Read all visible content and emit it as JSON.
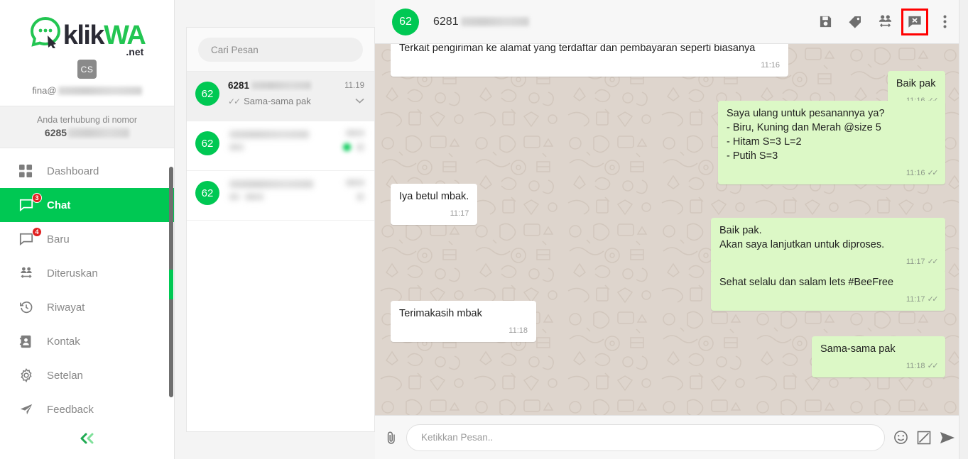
{
  "brand": {
    "logo_klik": "klik",
    "logo_wa": "WA",
    "logo_net": ".net",
    "accent_green": "#00c853",
    "badge_red": "#e02020",
    "highlight_red": "#ff0000",
    "bubble_out": "#dcf8c6",
    "bubble_in": "#ffffff",
    "chat_bg": "#ded5cd"
  },
  "sidebar": {
    "avatar_initials": "CS",
    "user_email_visible": "fina@",
    "connected_label": "Anda terhubung di nomor",
    "connected_number_visible": "6285",
    "items": [
      {
        "label": "Dashboard",
        "icon": "grid-icon",
        "badge": "",
        "active": false
      },
      {
        "label": "Chat",
        "icon": "chat-bubble-icon",
        "badge": "3",
        "active": true
      },
      {
        "label": "Baru",
        "icon": "chat-bubble-icon",
        "badge": "4",
        "active": false
      },
      {
        "label": "Diteruskan",
        "icon": "forward-people-icon",
        "badge": "",
        "active": false
      },
      {
        "label": "Riwayat",
        "icon": "history-clock-icon",
        "badge": "",
        "active": false
      },
      {
        "label": "Kontak",
        "icon": "contact-book-icon",
        "badge": "",
        "active": false
      },
      {
        "label": "Setelan",
        "icon": "gear-icon",
        "badge": "",
        "active": false
      },
      {
        "label": "Feedback",
        "icon": "paper-plane-icon",
        "badge": "",
        "active": false
      }
    ],
    "collapse_icon": "double-chevron-left-icon"
  },
  "chat_list": {
    "search_placeholder": "Cari Pesan",
    "rows": [
      {
        "avatar": "62",
        "name": "6281",
        "name_redacted": true,
        "time": "11.19",
        "snippet": "Sama-sama pak",
        "ticks": "✓✓",
        "selected": true,
        "blurred": false,
        "unread": false
      },
      {
        "avatar": "62",
        "name": "",
        "name_redacted": true,
        "time": "",
        "snippet": "",
        "ticks": "",
        "selected": false,
        "blurred": true,
        "unread": true
      },
      {
        "avatar": "62",
        "name": "",
        "name_redacted": true,
        "time": "",
        "snippet": "",
        "ticks": "",
        "selected": false,
        "blurred": true,
        "unread": false
      }
    ]
  },
  "conversation": {
    "header": {
      "avatar": "62",
      "title": "6281",
      "tools": [
        {
          "name": "save-icon",
          "label": "Simpan",
          "highlighted": false
        },
        {
          "name": "tag-icon",
          "label": "Label",
          "highlighted": false
        },
        {
          "name": "transfer-contact-icon",
          "label": "Teruskan",
          "highlighted": false
        },
        {
          "name": "close-chat-icon",
          "label": "Tutup Chat",
          "highlighted": true
        },
        {
          "name": "kebab-menu-icon",
          "label": "Menu",
          "highlighted": false
        }
      ]
    },
    "messages": [
      {
        "id": "m1",
        "side": "in",
        "lines": [
          "Terkait pengiriman ke alamat yang terdaftar dan pembayaran seperti biasanya"
        ],
        "time": "11:16",
        "ticks": "",
        "clipped_top": true
      },
      {
        "id": "m2",
        "side": "out",
        "lines": [
          "Baik pak"
        ],
        "time": "11:16",
        "ticks": "✓✓"
      },
      {
        "id": "m3",
        "side": "out",
        "lines": [
          "Saya ulang untuk pesanannya ya?",
          "- Biru, Kuning dan Merah @size 5",
          "- Hitam S=3 L=2",
          "- Putih S=3"
        ],
        "time": "11:16",
        "ticks": "✓✓"
      },
      {
        "id": "m4",
        "side": "in",
        "lines": [
          "Iya betul mbak."
        ],
        "time": "11:17",
        "ticks": ""
      },
      {
        "id": "m5",
        "side": "out",
        "lines": [
          "Baik pak.",
          "Akan saya lanjutkan untuk diproses."
        ],
        "time": "11:17",
        "ticks": "✓✓"
      },
      {
        "id": "m6",
        "side": "out",
        "lines": [
          "Sehat selalu dan salam lets #BeeFree"
        ],
        "time": "11:17",
        "ticks": "✓✓"
      },
      {
        "id": "m7",
        "side": "in",
        "lines": [
          "Terimakasih mbak"
        ],
        "time": "11:18",
        "ticks": ""
      },
      {
        "id": "m8",
        "side": "out",
        "lines": [
          "Sama-sama pak"
        ],
        "time": "11:18",
        "ticks": "✓✓"
      }
    ],
    "composer": {
      "attach_icon": "paperclip-icon",
      "placeholder": "Ketikkan Pesan..",
      "value": "",
      "emoji_icon": "emoji-smiley-icon",
      "template_icon": "template-note-icon",
      "send_icon": "send-plane-icon"
    }
  }
}
